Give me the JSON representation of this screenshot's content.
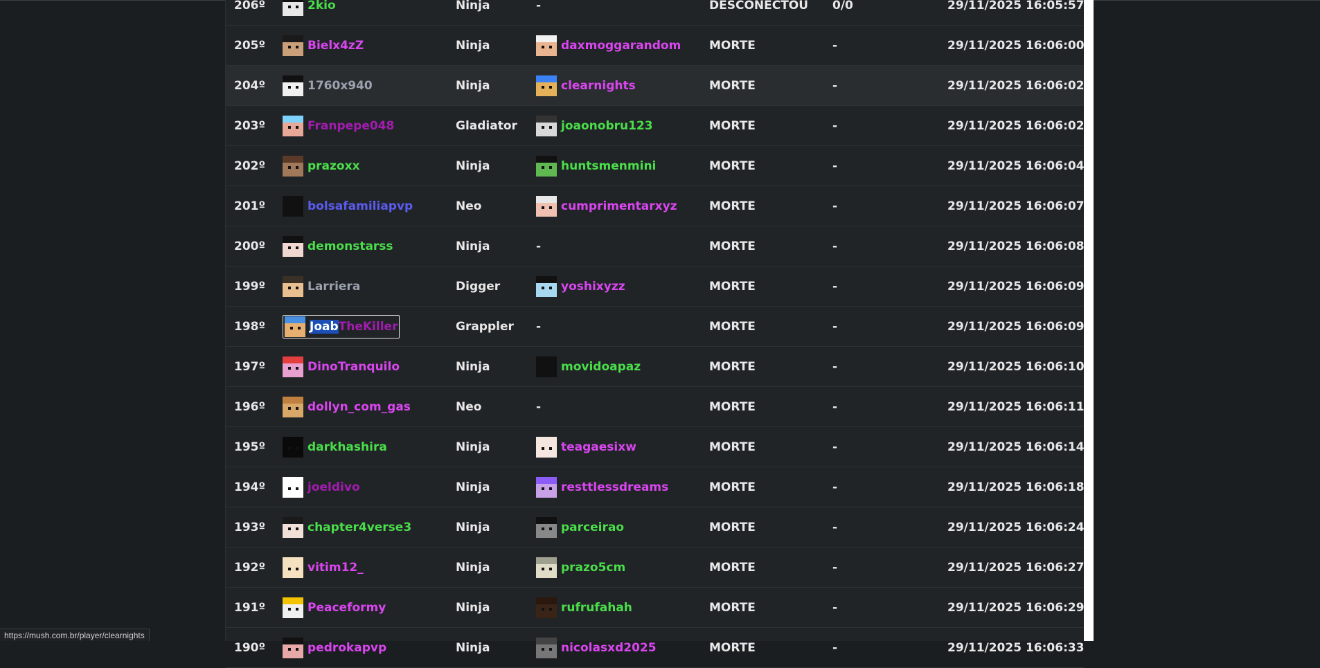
{
  "colors": {
    "green": "#4ade4a",
    "magenta": "#d946ef",
    "purple": "#a21caf",
    "blue": "#5b5bf0",
    "gray": "#9ca3af",
    "white": "#e8e8e8"
  },
  "rows": [
    {
      "rank": "206º",
      "p1": "2kio",
      "p1_color": "#4ade4a",
      "p1_skin": "#e8e8e8",
      "p1_hair": "#111",
      "kit": "Ninja",
      "p2": "-",
      "p2_color": "",
      "p2_skin": "",
      "p2_hair": "",
      "result": "DESCONECTOU",
      "kd": "0/0",
      "time": "29/11/2025 16:05:57"
    },
    {
      "rank": "205º",
      "p1": "Bielx4zZ",
      "p1_color": "#d946ef",
      "p1_skin": "#caa07a",
      "p1_hair": "#1a1a1a",
      "kit": "Ninja",
      "p2": "daxmoggarandom",
      "p2_color": "#d946ef",
      "p2_skin": "#e9b48f",
      "p2_hair": "#f2f2f2",
      "result": "MORTE",
      "kd": "-",
      "time": "29/11/2025 16:06:00"
    },
    {
      "rank": "204º",
      "p1": "1760x940",
      "p1_color": "#9ca3af",
      "p1_skin": "#f0f0f0",
      "p1_hair": "#111",
      "kit": "Ninja",
      "p2": "clearnights",
      "p2_color": "#d946ef",
      "p2_skin": "#e5b05a",
      "p2_hair": "#3b82f6",
      "result": "MORTE",
      "kd": "-",
      "time": "29/11/2025 16:06:02"
    },
    {
      "rank": "203º",
      "p1": "Franpepe048",
      "p1_color": "#a21caf",
      "p1_skin": "#e8a898",
      "p1_hair": "#7dd3fc",
      "kit": "Gladiator",
      "p2": "joaonobru123",
      "p2_color": "#4ade4a",
      "p2_skin": "#d8d8d8",
      "p2_hair": "#333",
      "result": "MORTE",
      "kd": "-",
      "time": "29/11/2025 16:06:02"
    },
    {
      "rank": "202º",
      "p1": "prazoxx",
      "p1_color": "#4ade4a",
      "p1_skin": "#a0785a",
      "p1_hair": "#5b3b28",
      "kit": "Ninja",
      "p2": "huntsmenmini",
      "p2_color": "#4ade4a",
      "p2_skin": "#5fb850",
      "p2_hair": "#111",
      "result": "MORTE",
      "kd": "-",
      "time": "29/11/2025 16:06:04"
    },
    {
      "rank": "201º",
      "p1": "bolsafamiliapvp",
      "p1_color": "#5b5bf0",
      "p1_skin": "#111",
      "p1_hair": "#111",
      "kit": "Neo",
      "p2": "cumprimentarxyz",
      "p2_color": "#d946ef",
      "p2_skin": "#f0c0b0",
      "p2_hair": "#e8e8e8",
      "result": "MORTE",
      "kd": "-",
      "time": "29/11/2025 16:06:07"
    },
    {
      "rank": "200º",
      "p1": "demonstarss",
      "p1_color": "#4ade4a",
      "p1_skin": "#f0d8d0",
      "p1_hair": "#111",
      "kit": "Ninja",
      "p2": "-",
      "p2_color": "",
      "p2_skin": "",
      "p2_hair": "",
      "result": "MORTE",
      "kd": "-",
      "time": "29/11/2025 16:06:08"
    },
    {
      "rank": "199º",
      "p1": "Larriera",
      "p1_color": "#9ca3af",
      "p1_skin": "#e8c090",
      "p1_hair": "#3b3026",
      "kit": "Digger",
      "p2": "yoshixyzz",
      "p2_color": "#d946ef",
      "p2_skin": "#a8d8f0",
      "p2_hair": "#111",
      "result": "MORTE",
      "kd": "-",
      "time": "29/11/2025 16:06:09"
    },
    {
      "rank": "198º",
      "p1": "JoabTheKiller",
      "p1_sel_a": "Joab",
      "p1_sel_b": "TheKiller",
      "p1_color": "#a21caf",
      "p1_skin": "#e8b070",
      "p1_hair": "#4a90e2",
      "kit": "Grappler",
      "p2": "-",
      "p2_color": "",
      "p2_skin": "",
      "p2_hair": "",
      "result": "MORTE",
      "kd": "-",
      "time": "29/11/2025 16:06:09",
      "selected": true
    },
    {
      "rank": "197º",
      "p1": "DinoTranquilo",
      "p1_color": "#d946ef",
      "p1_skin": "#e8a0d0",
      "p1_hair": "#e53e3e",
      "kit": "Ninja",
      "p2": "movidoapaz",
      "p2_color": "#4ade4a",
      "p2_skin": "#111",
      "p2_hair": "#111",
      "result": "MORTE",
      "kd": "-",
      "time": "29/11/2025 16:06:10"
    },
    {
      "rank": "196º",
      "p1": "dollyn_com_gas",
      "p1_color": "#d946ef",
      "p1_skin": "#d8a868",
      "p1_hair": "#c08040",
      "kit": "Neo",
      "p2": "-",
      "p2_color": "",
      "p2_skin": "",
      "p2_hair": "",
      "result": "MORTE",
      "kd": "-",
      "time": "29/11/2025 16:06:11"
    },
    {
      "rank": "195º",
      "p1": "darkhashira",
      "p1_color": "#4ade4a",
      "p1_skin": "#0a0a0a",
      "p1_hair": "#0a0a0a",
      "kit": "Ninja",
      "p2": "teagaesixw",
      "p2_color": "#d946ef",
      "p2_skin": "#f5e6e0",
      "p2_hair": "#f5e6e0",
      "result": "MORTE",
      "kd": "-",
      "time": "29/11/2025 16:06:14"
    },
    {
      "rank": "194º",
      "p1": "joeldivo",
      "p1_color": "#a21caf",
      "p1_skin": "#ffffff",
      "p1_hair": "#ffffff",
      "kit": "Ninja",
      "p2": "resttlessdreams",
      "p2_color": "#d946ef",
      "p2_skin": "#c8a0e8",
      "p2_hair": "#8b5cf6",
      "result": "MORTE",
      "kd": "-",
      "time": "29/11/2025 16:06:18"
    },
    {
      "rank": "193º",
      "p1": "chapter4verse3",
      "p1_color": "#4ade4a",
      "p1_skin": "#f0e0d8",
      "p1_hair": "#1a1a1a",
      "kit": "Ninja",
      "p2": "parceirao",
      "p2_color": "#4ade4a",
      "p2_skin": "#888",
      "p2_hair": "#111",
      "result": "MORTE",
      "kd": "-",
      "time": "29/11/2025 16:06:24"
    },
    {
      "rank": "192º",
      "p1": "vitim12_",
      "p1_color": "#d946ef",
      "p1_skin": "#f5e0c0",
      "p1_hair": "#f5e0c0",
      "kit": "Ninja",
      "p2": "prazo5cm",
      "p2_color": "#4ade4a",
      "p2_skin": "#e0dcc8",
      "p2_hair": "#a0a090",
      "result": "MORTE",
      "kd": "-",
      "time": "29/11/2025 16:06:27"
    },
    {
      "rank": "191º",
      "p1": "Peaceformy",
      "p1_color": "#d946ef",
      "p1_skin": "#f0f0f0",
      "p1_hair": "#f5c400",
      "kit": "Ninja",
      "p2": "rufrufahah",
      "p2_color": "#4ade4a",
      "p2_skin": "#3a2418",
      "p2_hair": "#2a180e",
      "result": "MORTE",
      "kd": "-",
      "time": "29/11/2025 16:06:29"
    },
    {
      "rank": "190º",
      "p1": "pedrokapvp",
      "p1_color": "#d946ef",
      "p1_skin": "#e8a8a8",
      "p1_hair": "#111",
      "kit": "Ninja",
      "p2": "nicolasxd2025",
      "p2_color": "#d946ef",
      "p2_skin": "#777",
      "p2_hair": "#444",
      "result": "MORTE",
      "kd": "-",
      "time": "29/11/2025 16:06:33"
    }
  ],
  "status_bar": {
    "url": "https://mush.com.br/player/clearnights"
  }
}
